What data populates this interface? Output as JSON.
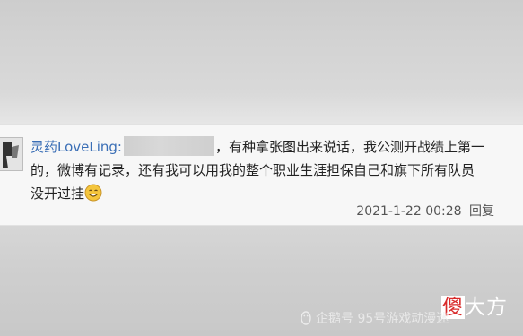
{
  "comment": {
    "username": "灵药LoveLing:",
    "text_line1": "，有种拿张图出来说话，我公测开战绩上第一",
    "text_line2": "的，微博有记录，还有我可以用我的整个职业生涯担保自己和旗下所有队员",
    "text_line3": "没开过挂",
    "emoji": "smile-icon",
    "timestamp": "2021-1-22 00:28",
    "reply_label": "回复"
  },
  "watermark": {
    "brand_first": "傻",
    "brand_rest": "大方",
    "source": "企鹅号 95号游戏动漫迷"
  },
  "colors": {
    "username": "#3b6fb6",
    "brand_red": "#d92b2b"
  }
}
